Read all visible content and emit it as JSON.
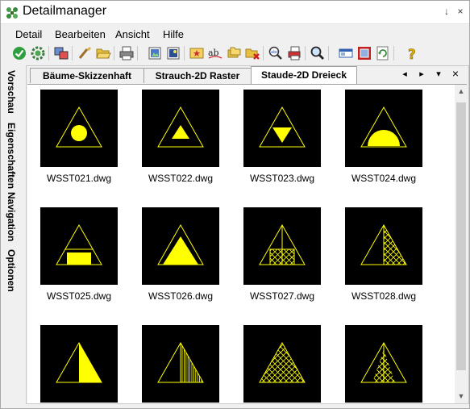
{
  "window": {
    "title": "Detailmanager",
    "pin_glyph": "↓",
    "close_glyph": "×"
  },
  "menu": [
    "Detail",
    "Bearbeiten",
    "Ansicht",
    "Hilfe"
  ],
  "toolbar_icons": [
    "check-icon",
    "settings-icon",
    "windows-icon",
    "brush-icon",
    "open-folder-icon",
    "print-icon",
    "image-icon",
    "image-frame-icon",
    "star-image-icon",
    "spellcheck-icon",
    "folders-icon",
    "folder-delete-icon",
    "abc-search-icon",
    "color-print-icon",
    "search-icon",
    "panel-icon",
    "red-square-icon",
    "refresh-icon",
    "help-icon"
  ],
  "sidebar_tabs": [
    "Vorschau",
    "Eigenschaften",
    "Navigation",
    "Optionen"
  ],
  "tabs": [
    "Bäume-Skizzenhaft",
    "Strauch-2D Raster",
    "Staude-2D Dreieck"
  ],
  "active_tab": "Staude-2D Dreieck",
  "tab_controls": {
    "prev": "◂",
    "next": "▸",
    "menu": "▾",
    "close": "×"
  },
  "scroll_glyphs": {
    "up": "▲",
    "down": "▼"
  },
  "colors": {
    "symbol": "#ffff00",
    "thumb_bg": "#000000"
  },
  "items": [
    {
      "file": "WSST021.dwg",
      "symbol": "circle"
    },
    {
      "file": "WSST022.dwg",
      "symbol": "triangle"
    },
    {
      "file": "WSST023.dwg",
      "symbol": "inverted-triangle"
    },
    {
      "file": "WSST024.dwg",
      "symbol": "semicircle"
    },
    {
      "file": "WSST025.dwg",
      "symbol": "rectangle"
    },
    {
      "file": "WSST026.dwg",
      "symbol": "filled-triangle"
    },
    {
      "file": "WSST027.dwg",
      "symbol": "grid-square"
    },
    {
      "file": "WSST028.dwg",
      "symbol": "half-hatch"
    },
    {
      "file": "",
      "symbol": "half-filled"
    },
    {
      "file": "",
      "symbol": "half-lines"
    },
    {
      "file": "",
      "symbol": "full-hatch"
    },
    {
      "file": "",
      "symbol": "center-hatch"
    }
  ]
}
